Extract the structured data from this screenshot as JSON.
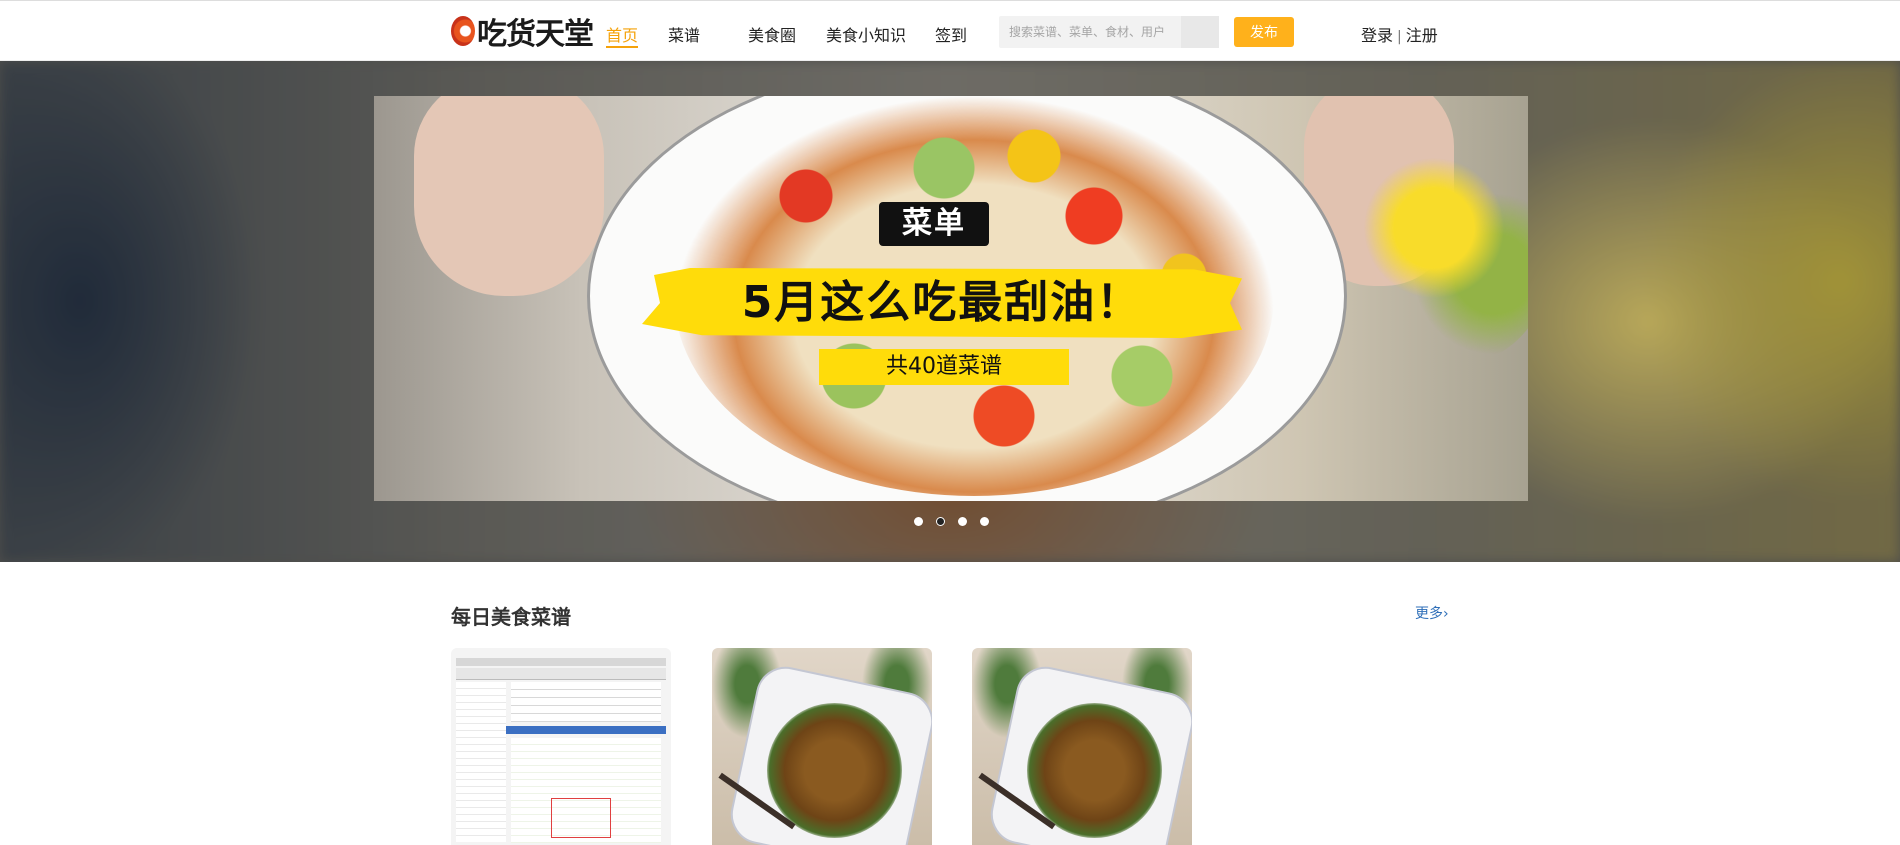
{
  "header": {
    "logo_text": "吃货天堂",
    "nav": [
      {
        "label": "首页",
        "active": true
      },
      {
        "label": "菜谱",
        "active": false
      },
      {
        "label": "美食圈",
        "active": false
      },
      {
        "label": "美食小知识",
        "active": false
      },
      {
        "label": "签到",
        "active": false
      }
    ],
    "search": {
      "placeholder": "搜索菜谱、菜单、食材、用户"
    },
    "publish_label": "发布",
    "login_label": "登录",
    "separator": "|",
    "register_label": "注册",
    "accent_color": "#f5a20a"
  },
  "banner": {
    "slide": {
      "tag": "菜单",
      "title": "5月这么吃最刮油！",
      "subtitle": "共40道菜谱"
    },
    "dots_count": 4,
    "active_dot_index": 1
  },
  "section": {
    "title": "每日美食菜谱",
    "more_label": "更多",
    "more_icon": "chevron-right-icon",
    "cards": [
      {
        "image": "software-screenshot-thumbnail"
      },
      {
        "image": "stir-fry-dish-photo"
      },
      {
        "image": "stir-fry-dish-photo"
      }
    ]
  }
}
